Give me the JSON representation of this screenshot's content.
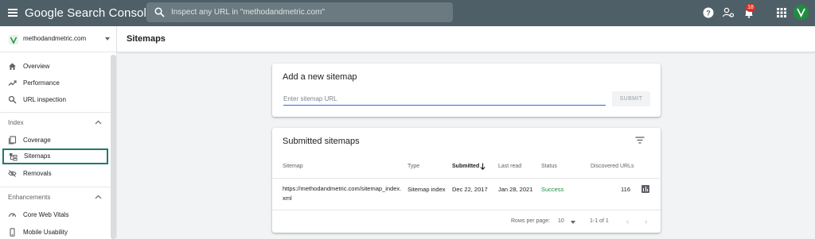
{
  "topbar": {
    "app_title": "Google Search Console",
    "search_placeholder": "Inspect any URL in \"methodandmetric.com\"",
    "notification_count": "18",
    "icons": [
      "menu-icon",
      "search-icon",
      "help-icon",
      "manage-accounts-icon",
      "bell-icon",
      "apps-icon",
      "avatar"
    ]
  },
  "sidebar": {
    "property": "methodandmetric.com",
    "items_top": [
      {
        "label": "Overview",
        "icon": "home-icon"
      },
      {
        "label": "Performance",
        "icon": "trending-up-icon"
      },
      {
        "label": "URL inspection",
        "icon": "search-icon"
      }
    ],
    "index_section": {
      "label": "Index",
      "items": [
        {
          "label": "Coverage",
          "icon": "pages-icon"
        },
        {
          "label": "Sitemaps",
          "icon": "sitemap-icon",
          "active": true
        },
        {
          "label": "Removals",
          "icon": "eye-off-icon"
        }
      ]
    },
    "enhancements_section": {
      "label": "Enhancements",
      "items": [
        {
          "label": "Core Web Vitals",
          "icon": "speed-icon"
        },
        {
          "label": "Mobile Usability",
          "icon": "phone-icon"
        }
      ]
    }
  },
  "header": {
    "title": "Sitemaps"
  },
  "add_sitemap": {
    "title": "Add a new sitemap",
    "placeholder": "Enter sitemap URL",
    "submit_label": "SUBMIT"
  },
  "submitted": {
    "title": "Submitted sitemaps",
    "columns": [
      "Sitemap",
      "Type",
      "Submitted",
      "Last read",
      "Status",
      "Discovered URLs"
    ],
    "rows": [
      {
        "sitemap": "https://methodandmetric.com/sitemap_index.xml",
        "type": "Sitemap index",
        "submitted": "Dec 22, 2017",
        "last_read": "Jan 28, 2021",
        "status": "Success",
        "discovered": "116"
      }
    ],
    "footer": {
      "rows_per_page_label": "Rows per page:",
      "rows_per_page": "10",
      "range": "1-1 of 1",
      "prev": "‹",
      "next": "›"
    }
  },
  "colors": {
    "topbar": "#4e5f67",
    "accent": "#1a73e8",
    "success": "#1e8e3e",
    "active_outline": "#1f7a6b"
  }
}
